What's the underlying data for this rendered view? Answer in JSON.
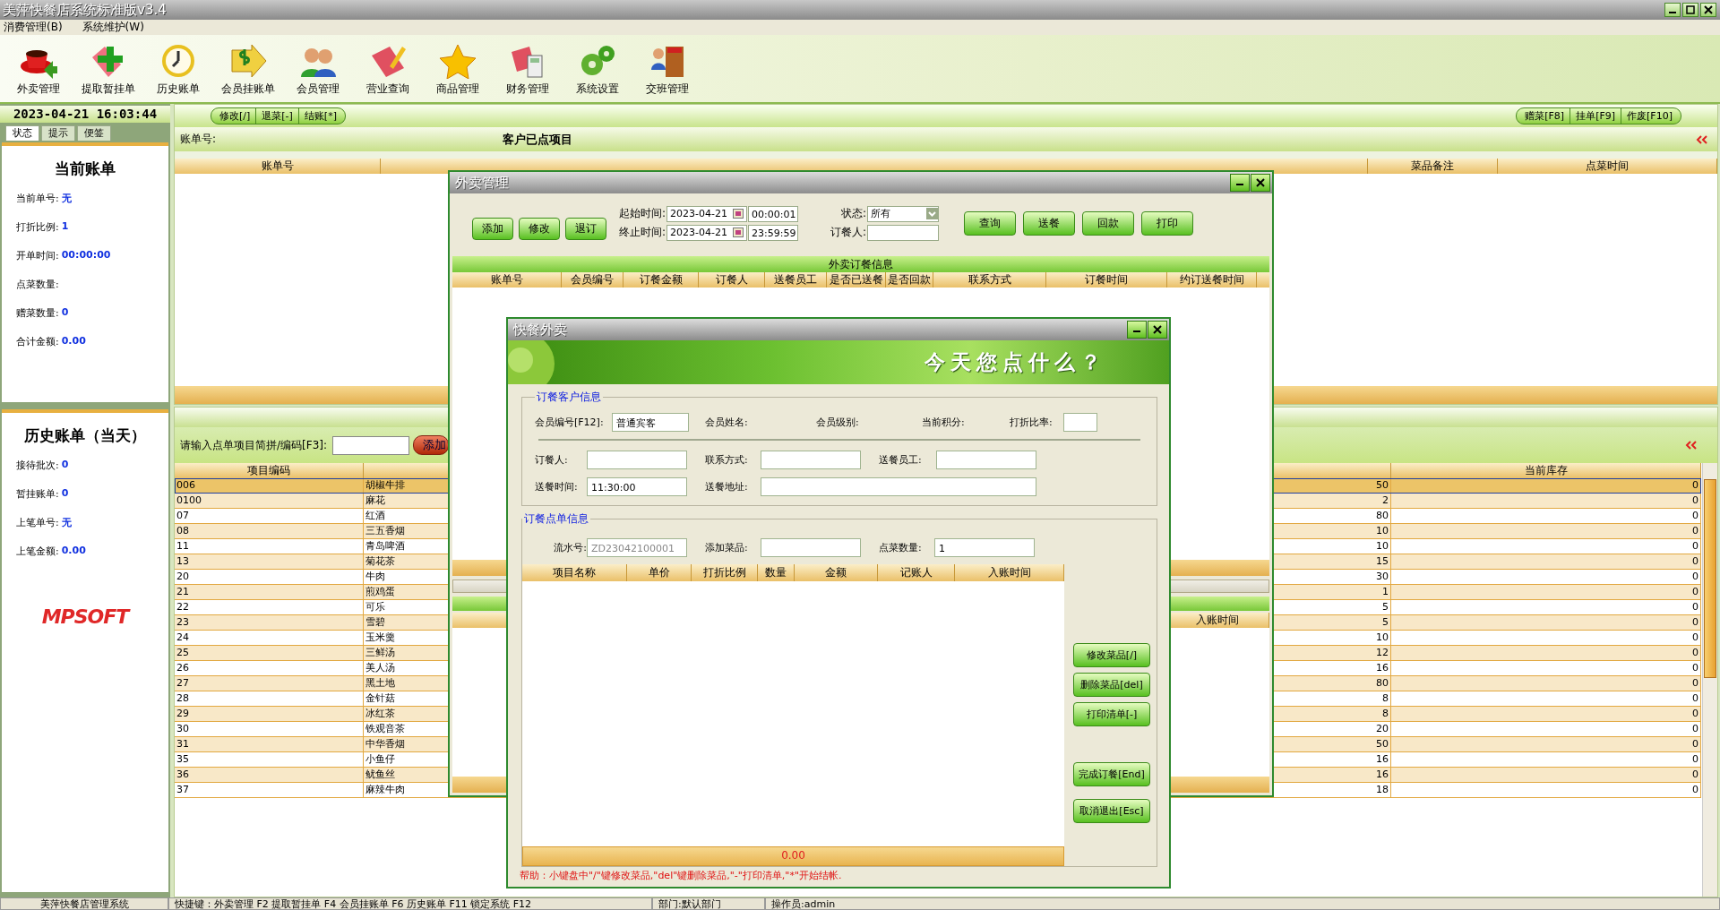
{
  "window": {
    "title": "美萍快餐店系统标准版v3.4"
  },
  "menu": [
    "消费管理(B)",
    "系统维护(W)"
  ],
  "toolbar": [
    {
      "label": "外卖管理",
      "kind": "cup"
    },
    {
      "label": "提取暂挂单",
      "kind": "plus"
    },
    {
      "label": "历史账单",
      "kind": "clock"
    },
    {
      "label": "会员挂账单",
      "kind": "dollar"
    },
    {
      "label": "会员管理",
      "kind": "people"
    },
    {
      "label": "营业查询",
      "kind": "notebook"
    },
    {
      "label": "商品管理",
      "kind": "star"
    },
    {
      "label": "财务管理",
      "kind": "calculator"
    },
    {
      "label": "系统设置",
      "kind": "gears"
    },
    {
      "label": "交班管理",
      "kind": "exit"
    }
  ],
  "clock": "2023-04-21 16:03:44",
  "side_tabs": [
    {
      "label": "状态",
      "selected": true
    },
    {
      "label": "提示",
      "selected": false
    },
    {
      "label": "便签",
      "selected": false
    }
  ],
  "current_bill": {
    "title": "当前账单",
    "fields": [
      {
        "label": "当前单号:",
        "value": "无"
      },
      {
        "label": "打折比例:",
        "value": "1"
      },
      {
        "label": "开单时间:",
        "value": "00:00:00"
      },
      {
        "label": "点菜数量:"
      },
      {
        "label": "赠菜数量:",
        "value": "0"
      },
      {
        "label": "合计金额:",
        "value": "0.00"
      }
    ]
  },
  "history": {
    "title": "历史账单（当天）",
    "fields": [
      {
        "label": "接待批次:",
        "value": "0"
      },
      {
        "label": "暂挂账单:",
        "value": "0"
      },
      {
        "label": "上笔单号:",
        "value": "无"
      },
      {
        "label": "上笔金额:",
        "value": "0.00"
      }
    ]
  },
  "logo": "MPSOFT",
  "order_panel": {
    "left_buttons": [
      "修改[/]",
      "退菜[-]",
      "结账[*]"
    ],
    "right_buttons": [
      "赠菜[F8]",
      "挂单[F9]",
      "作废[F10]"
    ],
    "bill_label": "账单号:",
    "title": "客户已点项目",
    "columns": [
      "账单号",
      "菜品备注",
      "点菜时间"
    ]
  },
  "items_panel": {
    "search_label": "请输入点单项目简拼/编码[F3]:",
    "add_button": "添加",
    "columns": [
      "项目编码",
      "当前库存"
    ],
    "rows": [
      {
        "code": "006",
        "name": "胡椒牛排",
        "column_3": "50",
        "stock": "0",
        "selected": true
      },
      {
        "code": "0100",
        "name": "麻花",
        "column_3": "2",
        "stock": "0",
        "selected": false
      },
      {
        "code": "07",
        "name": "红酒",
        "column_3": "80",
        "stock": "0",
        "selected": false
      },
      {
        "code": "08",
        "name": "三五香烟",
        "column_3": "10",
        "stock": "0",
        "selected": false
      },
      {
        "code": "11",
        "name": "青岛啤酒",
        "column_3": "10",
        "stock": "0",
        "selected": false
      },
      {
        "code": "13",
        "name": "菊花茶",
        "column_3": "15",
        "stock": "0",
        "selected": false
      },
      {
        "code": "20",
        "name": "牛肉",
        "column_3": "30",
        "stock": "0",
        "selected": false
      },
      {
        "code": "21",
        "name": "煎鸡蛋",
        "column_3": "1",
        "stock": "0",
        "selected": false
      },
      {
        "code": "22",
        "name": "可乐",
        "column_3": "5",
        "stock": "0",
        "selected": false
      },
      {
        "code": "23",
        "name": "雪碧",
        "column_3": "5",
        "stock": "0",
        "selected": false
      },
      {
        "code": "24",
        "name": "玉米羹",
        "column_3": "10",
        "stock": "0",
        "selected": false
      },
      {
        "code": "25",
        "name": "三鲜汤",
        "column_3": "12",
        "stock": "0",
        "selected": false
      },
      {
        "code": "26",
        "name": "美人汤",
        "column_3": "16",
        "stock": "0",
        "selected": false
      },
      {
        "code": "27",
        "name": "黑土地",
        "column_3": "80",
        "stock": "0",
        "selected": false
      },
      {
        "code": "28",
        "name": "金针菇",
        "column_3": "8",
        "stock": "0",
        "selected": false
      },
      {
        "code": "29",
        "name": "冰红茶",
        "column_3": "8",
        "stock": "0",
        "selected": false
      },
      {
        "code": "30",
        "name": "铁观音茶",
        "column_3": "20",
        "stock": "0",
        "selected": false
      },
      {
        "code": "31",
        "name": "中华香烟",
        "column_3": "50",
        "stock": "0",
        "selected": false
      },
      {
        "code": "35",
        "name": "小鱼仔",
        "column_3": "16",
        "stock": "0",
        "selected": false
      },
      {
        "code": "36",
        "name": "鱿鱼丝",
        "column_3": "16",
        "stock": "0",
        "selected": false
      },
      {
        "code": "37",
        "name": "麻辣牛肉",
        "column_3": "18",
        "stock": "0",
        "selected": false
      }
    ]
  },
  "takeout_window": {
    "title": "外卖管理",
    "buttons_left": [
      "添加",
      "修改",
      "退订"
    ],
    "start_label": "起始时间:",
    "start_date": "2023-04-21",
    "start_time": "00:00:01",
    "end_label": "终止时间:",
    "end_date": "2023-04-21",
    "end_time": "23:59:59",
    "status_label": "状态:",
    "status_value": "所有",
    "orderer_label": "订餐人:",
    "buttons_right": [
      "查询",
      "送餐",
      "回款",
      "打印"
    ],
    "table_title": "外卖订餐信息",
    "columns": [
      "账单号",
      "会员编号",
      "订餐金额",
      "订餐人",
      "送餐员工",
      "是否已送餐",
      "是否回款",
      "联系方式",
      "订餐时间",
      "约订送餐时间"
    ],
    "detail_columns": [
      "入账时间"
    ]
  },
  "order_dialog": {
    "title": "快餐外卖",
    "banner": "今天您点什么？",
    "customer_group": "订餐客户信息",
    "member_no_label": "会员编号[F12]:",
    "member_no": "普通宾客",
    "member_name_label": "会员姓名:",
    "member_level_label": "会员级别:",
    "points_label": "当前积分:",
    "discount_label": "打折比率:",
    "orderer_label": "订餐人:",
    "contact_label": "联系方式:",
    "courier_label": "送餐员工:",
    "time_label": "送餐时间:",
    "time_value": "11:30:00",
    "address_label": "送餐地址:",
    "order_group": "订餐点单信息",
    "serial_label": "流水号:",
    "serial_value": "ZD23042100001",
    "serial_disabled": true,
    "add_dish_label": "添加菜品:",
    "qty_label": "点菜数量:",
    "qty_value": "1",
    "columns": [
      "项目名称",
      "单价",
      "打折比例",
      "数量",
      "金额",
      "记账人",
      "入账时间"
    ],
    "total": "0.00",
    "buttons": [
      "修改菜品[/]",
      "删除菜品[del]",
      "打印清单[-]",
      "完成订餐[End]",
      "取消退出[Esc]"
    ],
    "help": "帮助：小键盘中\"/\"键修改菜品,\"del\"键删除菜品,\"-\"打印清单,\"*\"开始结帐."
  },
  "status_bar": [
    "美萍快餐店管理系统",
    "快捷键：外卖管理 F2  提取暂挂单 F4  会员挂账单 F6  历史账单 F11  锁定系统 F12",
    "部门:默认部门",
    "操作员:admin"
  ]
}
